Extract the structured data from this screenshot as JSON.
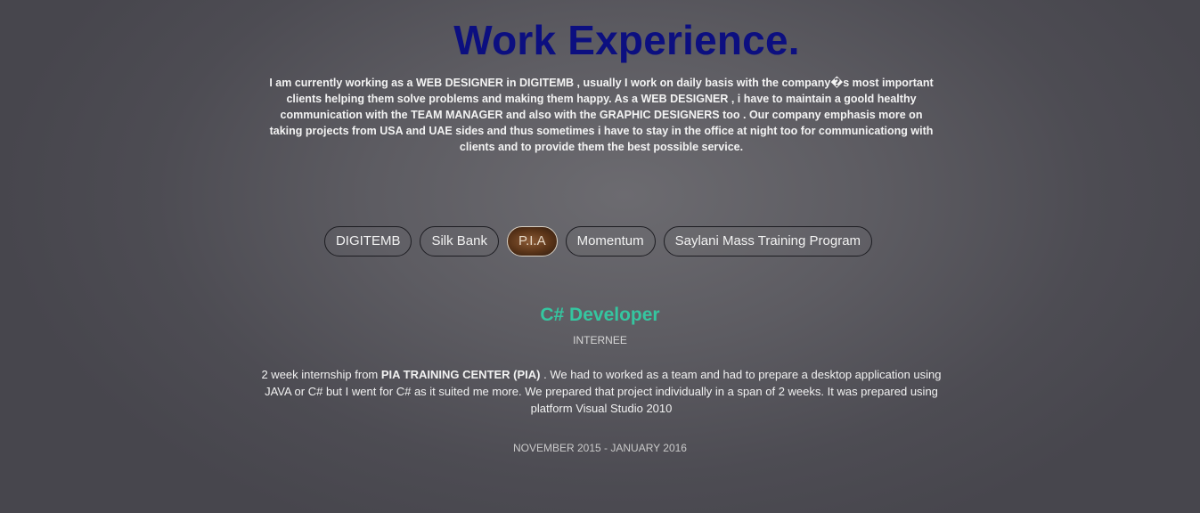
{
  "section": {
    "title": "Work Experience.",
    "intro": "I am currently working as a WEB DESIGNER in DIGITEMB , usually I work on daily basis with the company�s most important clients helping them solve problems and making them happy. As a WEB DESIGNER , i have to maintain a goold healthy communication with the TEAM MANAGER and also with the GRAPHIC DESIGNERS too . Our company emphasis more on taking projects from USA and UAE sides and thus sometimes i have to stay in the office at night too for communicationg with clients and to provide them the best possible service."
  },
  "tabs": [
    {
      "label": "DIGITEMB"
    },
    {
      "label": "Silk Bank"
    },
    {
      "label": "P.I.A"
    },
    {
      "label": "Momentum"
    },
    {
      "label": "Saylani Mass Training Program"
    }
  ],
  "active_tab": "P.I.A",
  "colors": {
    "title": "#0c0f80",
    "accent": "#35c6a0"
  },
  "job": {
    "title": "C# Developer",
    "role": "INTERNEE",
    "desc_before": "2 week internship from ",
    "desc_bold": "PIA TRAINING CENTER (PIA)",
    "desc_after": " . We had to worked as a team and had to prepare a desktop application using JAVA or C# but I went for C# as it suited me more. We prepared that project individually in a span of 2 weeks. It was prepared using platform Visual Studio 2010",
    "dates": "NOVEMBER 2015 - JANUARY 2016"
  }
}
